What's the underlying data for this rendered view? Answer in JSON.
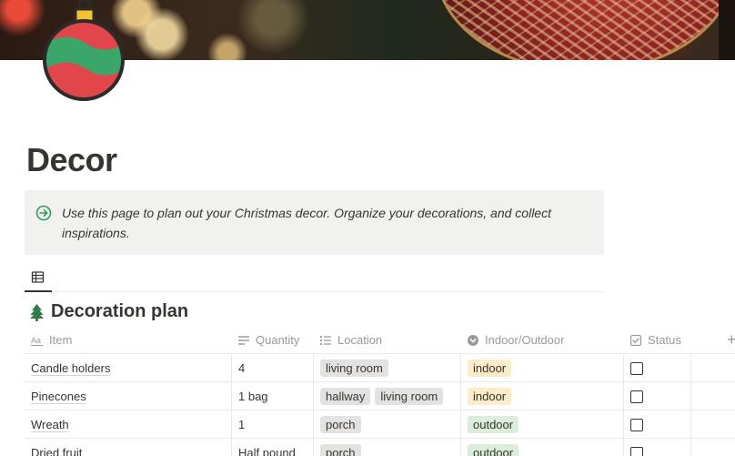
{
  "page": {
    "title": "Decor",
    "icon": "ornament-icon"
  },
  "callout": {
    "icon": "arrow-circle-right-icon",
    "text": "Use this page to plan out your Christmas decor. Organize your decorations, and collect inspirations."
  },
  "view": {
    "tab_icon": "table-icon"
  },
  "database": {
    "icon": "christmas-tree-icon",
    "title": "Decoration plan",
    "columns": [
      {
        "label": "Item",
        "icon": "title-aa-icon"
      },
      {
        "label": "Quantity",
        "icon": "text-lines-icon"
      },
      {
        "label": "Location",
        "icon": "list-icon"
      },
      {
        "label": "Indoor/Outdoor",
        "icon": "select-chevron-icon"
      },
      {
        "label": "Status",
        "icon": "checkbox-icon"
      }
    ],
    "add_column": "+",
    "more": "···",
    "rows": [
      {
        "item": "Candle holders",
        "quantity": "4",
        "location": [
          "living room"
        ],
        "io": "indoor",
        "status": false
      },
      {
        "item": "Pinecones",
        "quantity": "1 bag",
        "location": [
          "hallway",
          "living room"
        ],
        "io": "indoor",
        "status": false
      },
      {
        "item": "Wreath",
        "quantity": "1",
        "location": [
          "porch"
        ],
        "io": "outdoor",
        "status": false
      },
      {
        "item": "Dried fruit",
        "quantity": "Half pound",
        "location": [
          "porch"
        ],
        "io": "outdoor",
        "status": false
      }
    ]
  },
  "colors": {
    "text": "#37352f",
    "muted": "#9b9a97",
    "callout_bg": "#f1f1ef",
    "tag_gray": "#e3e2e0",
    "tag_yellow": "#fdecc8",
    "tag_green": "#dbeddb"
  }
}
